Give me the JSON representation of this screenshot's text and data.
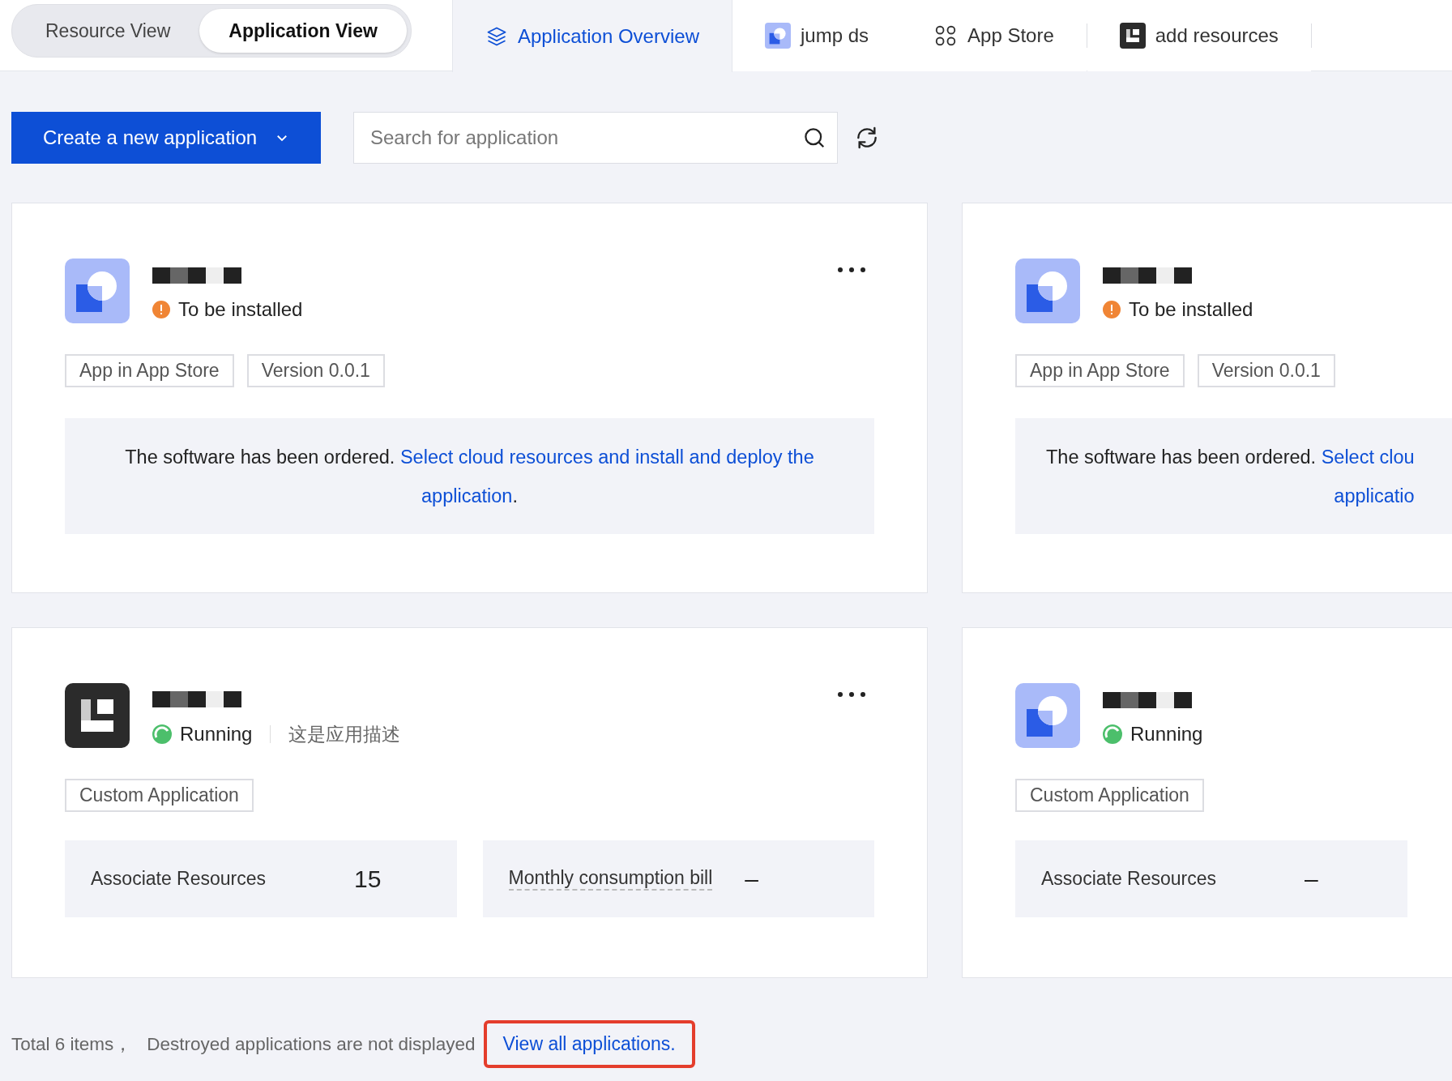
{
  "view_switch": [
    {
      "label": "Resource View",
      "selected": false
    },
    {
      "label": "Application View",
      "selected": true
    }
  ],
  "tabs": [
    {
      "label": "Application Overview",
      "selected": true
    },
    {
      "label": "jump ds",
      "selected": false
    },
    {
      "label": "App Store",
      "selected": false
    },
    {
      "label": "add resources",
      "selected": false
    }
  ],
  "create_button": {
    "label": "Create a new application"
  },
  "search": {
    "placeholder": "Search for application"
  },
  "cards": [
    {
      "menu": true,
      "status": {
        "kind": "pending",
        "label": "To be installed"
      },
      "tags": [
        "App in App Store",
        "Version 0.0.1"
      ],
      "notice": {
        "text": "The software has been ordered.",
        "link_parts": [
          "Select cloud resources and install and deploy the",
          "application"
        ],
        "suffix": "."
      }
    },
    {
      "menu": false,
      "status": {
        "kind": "pending",
        "label": "To be installed"
      },
      "tags": [
        "App in App Store",
        "Version 0.0.1"
      ],
      "notice": {
        "text": "The software has been ordered.",
        "link_parts": [
          "Select clou",
          "applicatio"
        ]
      }
    },
    {
      "menu": true,
      "status": {
        "kind": "running",
        "label": "Running"
      },
      "description": "这是应用描述",
      "tags": [
        "Custom Application"
      ],
      "stats": [
        {
          "label": "Associate Resources",
          "value": "15",
          "kind": "plain"
        },
        {
          "label": "Monthly consumption bill",
          "value": "–",
          "kind": "tooltip"
        }
      ]
    },
    {
      "menu": false,
      "status": {
        "kind": "running",
        "label": "Running"
      },
      "tags": [
        "Custom Application"
      ],
      "stats": [
        {
          "label": "Associate Resources",
          "value": "–",
          "kind": "plain"
        }
      ]
    }
  ],
  "footer": {
    "count": "Total 6 items，",
    "note": "Destroyed applications are not displayed",
    "link": "View all applications.",
    "highlighted": true
  }
}
